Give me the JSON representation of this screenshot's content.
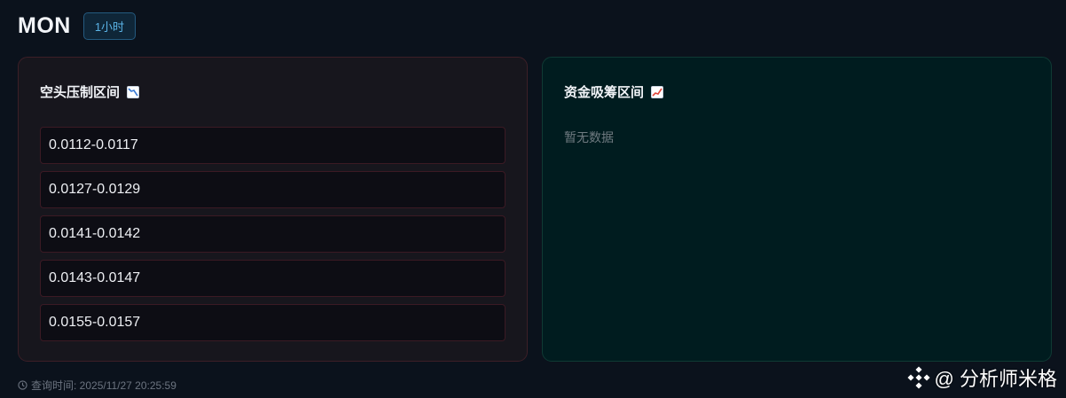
{
  "header": {
    "symbol": "MON",
    "timeframe": "1小时"
  },
  "short_panel": {
    "title": "空头压制区间",
    "icon": "chart-decreasing-icon",
    "ranges": [
      "0.0112-0.0117",
      "0.0127-0.0129",
      "0.0141-0.0142",
      "0.0143-0.0147",
      "0.0155-0.0157"
    ]
  },
  "long_panel": {
    "title": "资金吸筹区间",
    "icon": "chart-increasing-icon",
    "empty_text": "暂无数据"
  },
  "footer": {
    "query_time": "查询时间: 2025/11/27 20:25:59"
  },
  "watermark": {
    "text": "@ 分析师米格"
  },
  "colors": {
    "background": "#0b121c",
    "short_panel_bg": "#17161d",
    "long_panel_bg": "#001c1f",
    "badge_text": "#5ab3e6"
  }
}
